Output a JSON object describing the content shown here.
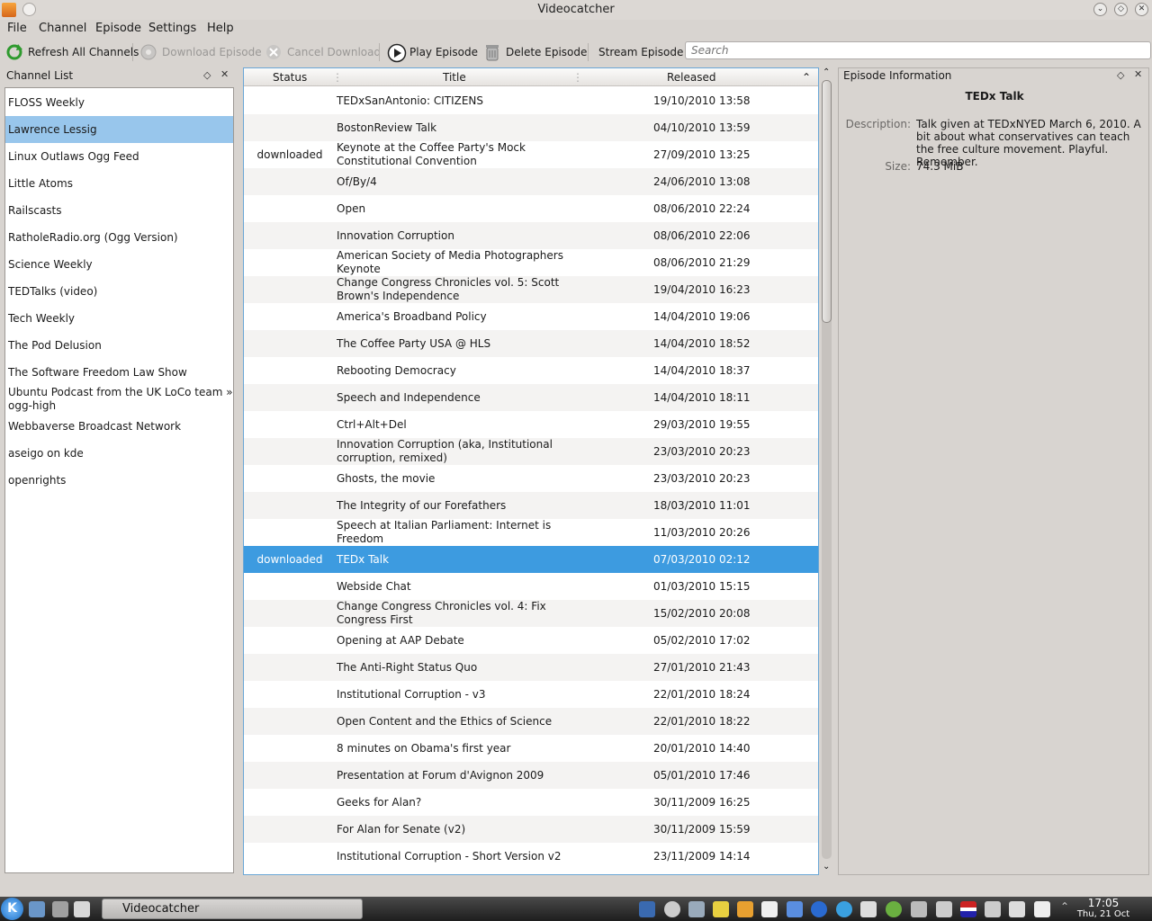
{
  "window": {
    "title": "Videocatcher"
  },
  "menu": [
    "File",
    "Channel",
    "Episode",
    "Settings",
    "Help"
  ],
  "toolbar": {
    "refresh": "Refresh All Channels",
    "download": "Download Episode",
    "cancel": "Cancel Download",
    "play": "Play Episode",
    "delete": "Delete Episode",
    "stream": "Stream Episode",
    "search_placeholder": "Search"
  },
  "channel_panel": {
    "title": "Channel List",
    "items": [
      "FLOSS Weekly",
      "Lawrence Lessig",
      "Linux Outlaws Ogg Feed",
      "Little Atoms",
      "Railscasts",
      "RatholeRadio.org (Ogg Version)",
      "Science Weekly",
      "TEDTalks (video)",
      "Tech Weekly",
      "The Pod Delusion",
      "The Software Freedom Law Show",
      "Ubuntu Podcast from the UK LoCo team » ogg-high",
      "Webbaverse Broadcast Network",
      "aseigo on kde",
      "openrights"
    ],
    "selected_index": 1
  },
  "episodes": {
    "columns": {
      "status": "Status",
      "title": "Title",
      "released": "Released"
    },
    "rows": [
      {
        "status": "",
        "title": "TEDxSanAntonio: CITIZENS",
        "released": "19/10/2010 13:58"
      },
      {
        "status": "",
        "title": "BostonReview Talk",
        "released": "04/10/2010 13:59"
      },
      {
        "status": "downloaded",
        "title": "Keynote at the Coffee Party's Mock Constitutional Convention",
        "released": "27/09/2010 13:25"
      },
      {
        "status": "",
        "title": "Of/By/4",
        "released": "24/06/2010 13:08"
      },
      {
        "status": "",
        "title": "Open",
        "released": "08/06/2010 22:24"
      },
      {
        "status": "",
        "title": "Innovation Corruption",
        "released": "08/06/2010 22:06"
      },
      {
        "status": "",
        "title": "American Society of Media Photographers Keynote",
        "released": "08/06/2010 21:29"
      },
      {
        "status": "",
        "title": "Change Congress Chronicles vol. 5: Scott Brown's Independence",
        "released": "19/04/2010 16:23"
      },
      {
        "status": "",
        "title": "America's Broadband Policy",
        "released": "14/04/2010 19:06"
      },
      {
        "status": "",
        "title": "The Coffee Party USA @ HLS",
        "released": "14/04/2010 18:52"
      },
      {
        "status": "",
        "title": "Rebooting Democracy",
        "released": "14/04/2010 18:37"
      },
      {
        "status": "",
        "title": "Speech and Independence",
        "released": "14/04/2010 18:11"
      },
      {
        "status": "",
        "title": "Ctrl+Alt+Del",
        "released": "29/03/2010 19:55"
      },
      {
        "status": "",
        "title": "Innovation Corruption (aka, Institutional corruption, remixed)",
        "released": "23/03/2010 20:23"
      },
      {
        "status": "",
        "title": "Ghosts, the movie",
        "released": "23/03/2010 20:23"
      },
      {
        "status": "",
        "title": "The Integrity of our Forefathers",
        "released": "18/03/2010 11:01"
      },
      {
        "status": "",
        "title": "Speech at Italian Parliament: Internet is Freedom",
        "released": "11/03/2010 20:26"
      },
      {
        "status": "downloaded",
        "title": "TEDx Talk",
        "released": "07/03/2010 02:12"
      },
      {
        "status": "",
        "title": "Webside Chat",
        "released": "01/03/2010 15:15"
      },
      {
        "status": "",
        "title": "Change Congress Chronicles vol. 4: Fix Congress First",
        "released": "15/02/2010 20:08"
      },
      {
        "status": "",
        "title": "Opening at AAP Debate",
        "released": "05/02/2010 17:02"
      },
      {
        "status": "",
        "title": "The Anti-Right Status Quo",
        "released": "27/01/2010 21:43"
      },
      {
        "status": "",
        "title": "Institutional Corruption - v3",
        "released": "22/01/2010 18:24"
      },
      {
        "status": "",
        "title": "Open Content and the Ethics of Science",
        "released": "22/01/2010 18:22"
      },
      {
        "status": "",
        "title": "8 minutes on Obama's first year",
        "released": "20/01/2010 14:40"
      },
      {
        "status": "",
        "title": "Presentation at Forum d'Avignon 2009",
        "released": "05/01/2010 17:46"
      },
      {
        "status": "",
        "title": "Geeks for Alan?",
        "released": "30/11/2009 16:25"
      },
      {
        "status": "",
        "title": "For Alan for Senate (v2)",
        "released": "30/11/2009 15:59"
      },
      {
        "status": "",
        "title": "Institutional Corruption - Short Version v2",
        "released": "23/11/2009 14:14"
      }
    ],
    "selected_index": 17
  },
  "episode_info": {
    "panel_title": "Episode Information",
    "name": "TEDx Talk",
    "description_label": "Description:",
    "description": "Talk given at TEDxNYED March 6, 2010. A bit about what conservatives can teach the free culture movement. Playful. Remember.",
    "size_label": "Size:",
    "size": "74.3 MiB"
  },
  "taskbar": {
    "task": "Videocatcher",
    "time": "17:05",
    "date": "Thu, 21 Oct"
  },
  "colors": {
    "selection": "#3d9be0",
    "channel_selection": "#98c6ec"
  }
}
